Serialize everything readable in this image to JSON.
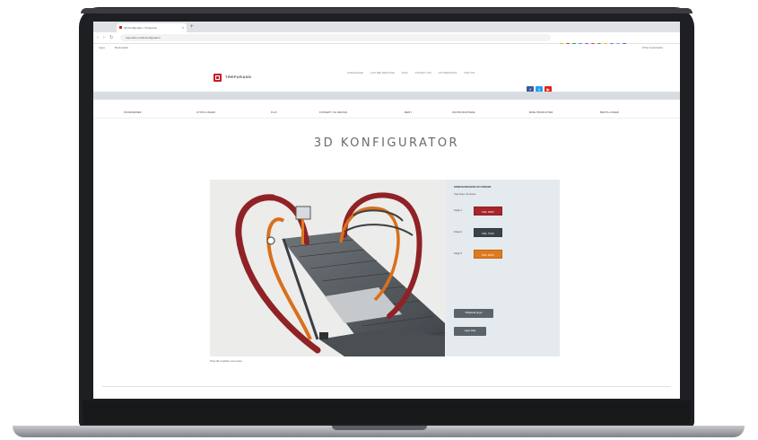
{
  "browser": {
    "tab_title": "3D Konfigurator | Trepurans",
    "new_tab": "+",
    "tab_close": "×",
    "url": "trepurans.no/3d-konfigurator/",
    "nav_icons": "‹ › ↻",
    "bookmarks": [
      "Apps",
      "Bookmarks"
    ],
    "other_bookmarks": "Other bookmarks",
    "window_dots": [
      "#ff5f57",
      "#febc2e",
      "#28c840"
    ],
    "extension_colors": [
      "#f4b400",
      "#db4437",
      "#0f9d58",
      "#4285f4",
      "#a142f4",
      "#ea4335",
      "#34a853",
      "#fbbc05",
      "#4285f4",
      "#9aa0a6",
      "#1a73e8"
    ]
  },
  "site": {
    "logo_text": "TREPURANS",
    "top_links": [
      "FORHANDLER",
      "LAST NED BROSJYRE",
      "KURV",
      "KONTAKT OSS",
      "OM TREPURANS",
      "FINN OSS"
    ],
    "social": [
      {
        "name": "facebook",
        "glyph": "f",
        "color": "#3b5998"
      },
      {
        "name": "twitter",
        "glyph": "t",
        "color": "#1da1f2"
      },
      {
        "name": "youtube",
        "glyph": "▶",
        "color": "#e62117"
      }
    ],
    "main_nav": [
      "STANDARDER",
      "UTSTILLINGER",
      "PLAY",
      "KONSEPT OG DESIGN",
      "MENY",
      "OM PRODUKTENE",
      "MINE PRODUKTER",
      "BESTILLINGER"
    ],
    "brand_color": "#c81d25"
  },
  "page": {
    "title": "3D KONFIGURATOR"
  },
  "configurator": {
    "panel_title": "KONFIGURASJON AV FARGER",
    "panel_subtitle": "Velg farger på delene",
    "colors": [
      {
        "label": "Farge 1",
        "value": "RAL 3003",
        "hex": "#a8252b"
      },
      {
        "label": "Farge 2",
        "value": "RAL 7016",
        "hex": "#3b4249"
      },
      {
        "label": "Farge 3",
        "value": "RAL 2004",
        "hex": "#e07a1f"
      }
    ],
    "buttons": [
      "Tilbakestill farger",
      "Lagre bilde"
    ],
    "caption": "Roter 3D-modellen med musen"
  }
}
